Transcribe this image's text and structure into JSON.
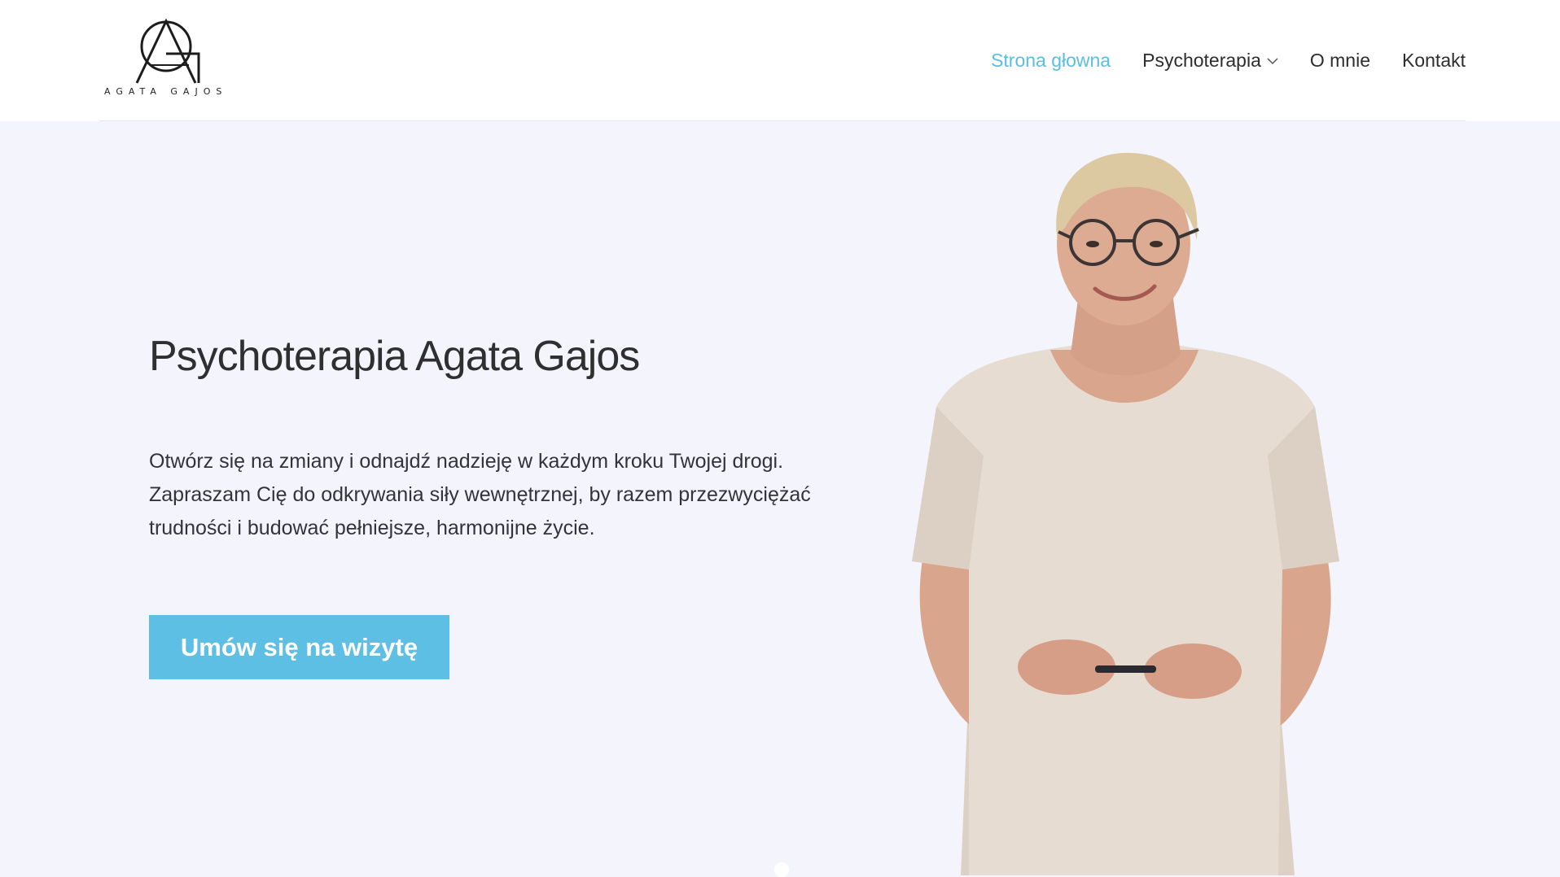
{
  "logo": {
    "text": "AGATA GAJOS"
  },
  "nav": {
    "items": [
      {
        "label": "Strona głowna",
        "active": true
      },
      {
        "label": "Psychoterapia",
        "has_dropdown": true
      },
      {
        "label": "O mnie"
      },
      {
        "label": "Kontakt"
      }
    ]
  },
  "hero": {
    "title": "Psychoterapia Agata Gajos",
    "text": "Otwórz się na zmiany i odnajdź nadzieję w każdym kroku Twojej drogi. Zapraszam Cię do odkrywania siły wewnętrznej, by razem przezwyciężać trudności i budować pełniejsze, harmonijne życie.",
    "cta_label": "Umów się na wizytę"
  },
  "colors": {
    "accent": "#5ebfe4",
    "background": "#f4f5fc",
    "text": "#2f2f31"
  },
  "slider": {
    "current_slide": 1
  }
}
